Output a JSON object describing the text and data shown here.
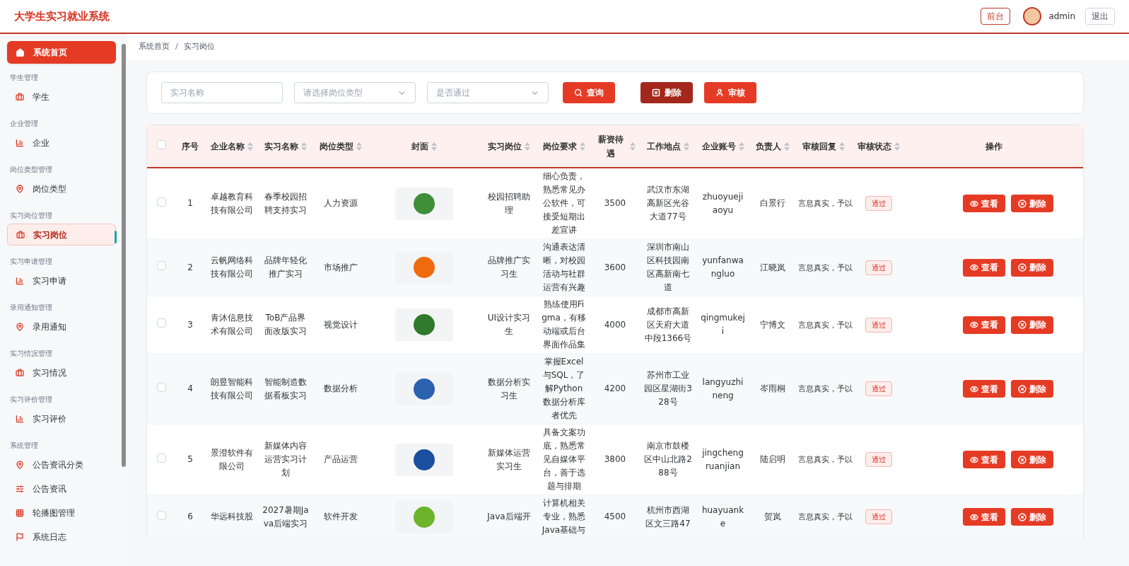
{
  "header": {
    "title": "大学生实习就业系统",
    "front_button": "前台",
    "user": "admin",
    "logout_button": "退出"
  },
  "sidebar": {
    "home": {
      "label": "系统首页",
      "selected": false
    },
    "groups": [
      {
        "title": "学生管理",
        "items": [
          {
            "label": "学生",
            "selected": false
          }
        ]
      },
      {
        "title": "企业管理",
        "items": [
          {
            "label": "企业",
            "selected": false
          }
        ]
      },
      {
        "title": "岗位类型管理",
        "items": [
          {
            "label": "岗位类型",
            "selected": false
          }
        ]
      },
      {
        "title": "实习岗位管理",
        "items": [
          {
            "label": "实习岗位",
            "selected": true
          }
        ]
      },
      {
        "title": "实习申请管理",
        "items": [
          {
            "label": "实习申请",
            "selected": false
          }
        ]
      },
      {
        "title": "录用通知管理",
        "items": [
          {
            "label": "录用通知",
            "selected": false
          }
        ]
      },
      {
        "title": "实习情况管理",
        "items": [
          {
            "label": "实习情况",
            "selected": false
          }
        ]
      },
      {
        "title": "实习评价管理",
        "items": [
          {
            "label": "实习评价",
            "selected": false
          }
        ]
      },
      {
        "title": "系统管理",
        "items": [
          {
            "label": "公告资讯分类",
            "selected": false
          },
          {
            "label": "公告资讯",
            "selected": false
          },
          {
            "label": "轮播图管理",
            "selected": false
          },
          {
            "label": "系统日志",
            "selected": false
          }
        ]
      }
    ]
  },
  "breadcrumb": {
    "separator": "/",
    "items": [
      "系统首页",
      "实习岗位"
    ]
  },
  "filters": {
    "name": {
      "placeholder": "实习名称"
    },
    "type": {
      "placeholder": "请选择岗位类型"
    },
    "passed": {
      "placeholder": "是否通过"
    },
    "buttons": [
      {
        "label": "查询",
        "kind": "search"
      },
      {
        "label": "删除",
        "kind": "delete"
      },
      {
        "label": "审核",
        "kind": "audit"
      }
    ]
  },
  "table": {
    "select_all": {
      "checked": false
    },
    "columns": [
      {
        "label": "序号",
        "sortable": false
      },
      {
        "label": "企业名称",
        "sortable": true
      },
      {
        "label": "实习名称",
        "sortable": true
      },
      {
        "label": "岗位类型",
        "sortable": true
      },
      {
        "label": "封面",
        "sortable": true
      },
      {
        "label": "实习岗位",
        "sortable": true
      },
      {
        "label": "岗位要求",
        "sortable": true
      },
      {
        "label": "薪资待遇",
        "sortable": true
      },
      {
        "label": "工作地点",
        "sortable": true
      },
      {
        "label": "企业账号",
        "sortable": true
      },
      {
        "label": "负责人",
        "sortable": true
      },
      {
        "label": "审核回复",
        "sortable": true
      },
      {
        "label": "审核状态",
        "sortable": true
      },
      {
        "label": "操作",
        "sortable": false
      }
    ],
    "rows": [
      {
        "checked": false,
        "no": "1",
        "company": "卓越教育科技有限公司",
        "name": "春季校园招聘支持实习",
        "type": "人力资源",
        "position": "校园招聘助理",
        "requirement": "细心负责，熟悉常见办公软件，可接受短期出差宣讲",
        "salary": "3500",
        "location": "武汉市东湖高新区光谷大道77号",
        "account": "zhuoyuejiaoyu",
        "manager": "白景行",
        "reply": "言息真实，予以",
        "status": "通过",
        "actions": [
          {
            "label": "查看",
            "kind": "view"
          },
          {
            "label": "删除",
            "kind": "delete"
          }
        ]
      },
      {
        "checked": false,
        "no": "2",
        "company": "云帆网络科技有限公司",
        "name": "品牌年轻化推广实习",
        "type": "市场推广",
        "position": "品牌推广实习生",
        "requirement": "沟通表达清晰，对校园活动与社群运营有兴趣",
        "salary": "3600",
        "location": "深圳市南山区科技园南区高新南七道",
        "account": "yunfanwangluo",
        "manager": "江晓岚",
        "reply": "言息真实，予以",
        "status": "通过",
        "actions": [
          {
            "label": "查看",
            "kind": "view"
          },
          {
            "label": "删除",
            "kind": "delete"
          }
        ]
      },
      {
        "checked": false,
        "no": "3",
        "company": "青沐信息技术有限公司",
        "name": "ToB产品界面改版实习",
        "type": "视觉设计",
        "position": "UI设计实习生",
        "requirement": "熟练使用Figma，有移动端或后台界面作品集",
        "salary": "4000",
        "location": "成都市高新区天府大道中段1366号",
        "account": "qingmukeji",
        "manager": "宁博文",
        "reply": "言息真实，予以",
        "status": "通过",
        "actions": [
          {
            "label": "查看",
            "kind": "view"
          },
          {
            "label": "删除",
            "kind": "delete"
          }
        ]
      },
      {
        "checked": false,
        "no": "4",
        "company": "朗昱智能科技有限公司",
        "name": "智能制造数据看板实习",
        "type": "数据分析",
        "position": "数据分析实习生",
        "requirement": "掌握Excel与SQL，了解Python数据分析库者优先",
        "salary": "4200",
        "location": "苏州市工业园区星湖街328号",
        "account": "langyuzhineng",
        "manager": "岑雨桐",
        "reply": "言息真实，予以",
        "status": "通过",
        "actions": [
          {
            "label": "查看",
            "kind": "view"
          },
          {
            "label": "删除",
            "kind": "delete"
          }
        ]
      },
      {
        "checked": false,
        "no": "5",
        "company": "景澄软件有限公司",
        "name": "新媒体内容运营实习计划",
        "type": "产品运营",
        "position": "新媒体运营实习生",
        "requirement": "具备文案功底，熟悉常见自媒体平台，善于选题与排期",
        "salary": "3800",
        "location": "南京市鼓楼区中山北路288号",
        "account": "jingchengruanjian",
        "manager": "陆启明",
        "reply": "言息真实，予以",
        "status": "通过",
        "actions": [
          {
            "label": "查看",
            "kind": "view"
          },
          {
            "label": "删除",
            "kind": "delete"
          }
        ]
      },
      {
        "checked": false,
        "no": "6",
        "company": "华远科技股",
        "name": "2027暑期Java后端实习",
        "type": "软件开发",
        "position": "Java后端开",
        "requirement": "计算机相关专业，熟悉Java基础与",
        "salary": "4500",
        "location": "杭州市西湖区文三路47",
        "account": "huayuanke",
        "manager": "贺岚",
        "reply": "言息真实，予以",
        "status": "通过",
        "actions": [
          {
            "label": "查看",
            "kind": "view"
          },
          {
            "label": "删除",
            "kind": "delete"
          }
        ]
      }
    ]
  }
}
